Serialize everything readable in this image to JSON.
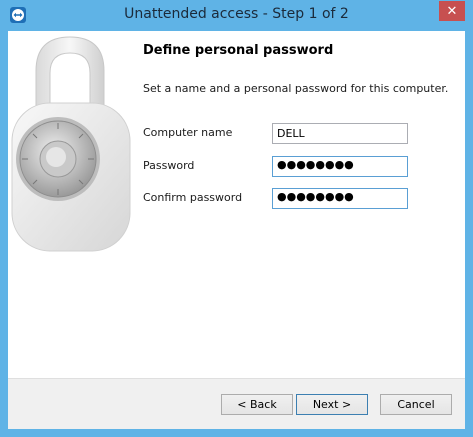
{
  "window": {
    "title": "Unattended access - Step 1 of 2",
    "close_glyph": "✕"
  },
  "page": {
    "heading": "Define personal password",
    "description": "Set a name and a personal password for this computer."
  },
  "form": {
    "computer_name": {
      "label": "Computer name",
      "value": "DELL"
    },
    "password": {
      "label": "Password",
      "value": "●●●●●●●●"
    },
    "confirm_password": {
      "label": "Confirm password",
      "value": "●●●●●●●●"
    }
  },
  "buttons": {
    "back": "< Back",
    "next": "Next >",
    "cancel": "Cancel"
  },
  "icons": {
    "app": "teamviewer-icon",
    "illustration": "combination-padlock-icon"
  }
}
